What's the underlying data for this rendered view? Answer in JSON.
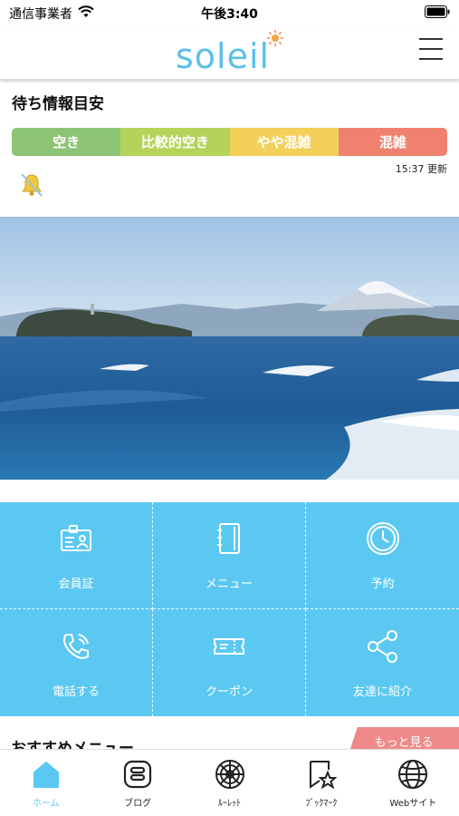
{
  "status_bar": {
    "carrier": "通信事業者",
    "time": "午後3:40"
  },
  "header": {
    "logo_text": "soleil"
  },
  "wait_info": {
    "title": "待ち情報目安",
    "levels": [
      {
        "label": "空き",
        "color": "#8cc474"
      },
      {
        "label": "比較的空き",
        "color": "#b5d35a"
      },
      {
        "label": "やや混雑",
        "color": "#f2d05a"
      },
      {
        "label": "混雑",
        "color": "#f0816e"
      }
    ],
    "updated": "15:37 更新"
  },
  "menu_grid": [
    {
      "label": "会員証",
      "icon": "member-card-icon"
    },
    {
      "label": "メニュー",
      "icon": "menu-book-icon"
    },
    {
      "label": "予約",
      "icon": "clock-icon"
    },
    {
      "label": "電話する",
      "icon": "phone-icon"
    },
    {
      "label": "クーポン",
      "icon": "coupon-icon"
    },
    {
      "label": "友達に紹介",
      "icon": "share-icon"
    }
  ],
  "recommended": {
    "title": "おすすめメニュー",
    "more_label": "もっと見る"
  },
  "tab_bar": [
    {
      "label": "ホーム",
      "icon": "home-icon",
      "active": true
    },
    {
      "label": "ブログ",
      "icon": "blog-icon",
      "active": false
    },
    {
      "label": "ﾙｰﾚｯﾄ",
      "icon": "roulette-icon",
      "active": false
    },
    {
      "label": "ﾌﾞｯｸﾏｰｸ",
      "icon": "bookmark-icon",
      "active": false
    },
    {
      "label": "Webサイト",
      "icon": "globe-icon",
      "active": false
    }
  ],
  "colors": {
    "accent": "#5bc8f2",
    "more_button": "#f08a8a"
  }
}
